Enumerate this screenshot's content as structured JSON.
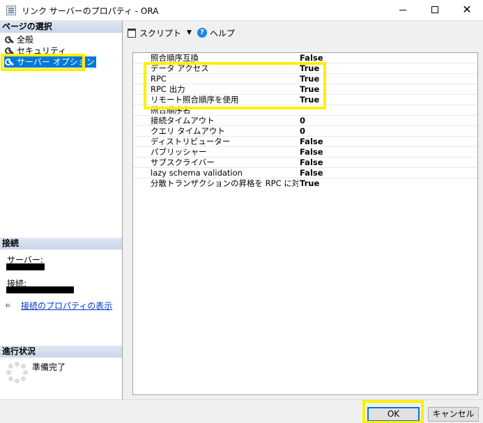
{
  "window": {
    "title": "リンク サーバーのプロパティ - ORA",
    "minimize": "—",
    "close": "✕"
  },
  "left": {
    "page_select_header": "ページの選択",
    "pages": [
      {
        "label": "全般",
        "icon": "wrench-icon"
      },
      {
        "label": "セキュリティ",
        "icon": "wrench-icon"
      },
      {
        "label": "サーバー オプション",
        "icon": "wrench-icon",
        "selected": true
      }
    ],
    "connection_header": "接続",
    "server_label": "サーバー:",
    "connection_label": "接続:",
    "view_connection_props": "接続のプロパティの表示",
    "progress_header": "進行状況",
    "progress_status": "準備完了"
  },
  "toolbar": {
    "script_label": "スクリプト",
    "help_label": "ヘルプ"
  },
  "grid": {
    "rows": [
      {
        "name": "照合順序互換",
        "value": "False"
      },
      {
        "name": "データ アクセス",
        "value": "True"
      },
      {
        "name": "RPC",
        "value": "True"
      },
      {
        "name": "RPC 出力",
        "value": "True"
      },
      {
        "name": "リモート照合順序を使用",
        "value": "True"
      },
      {
        "name": "照合順序名",
        "value": ""
      },
      {
        "name": "接続タイムアウト",
        "value": "0"
      },
      {
        "name": "クエリ タイムアウト",
        "value": "0"
      },
      {
        "name": "ディストリビューター",
        "value": "False"
      },
      {
        "name": "パブリッシャー",
        "value": "False"
      },
      {
        "name": "サブスクライバー",
        "value": "False"
      },
      {
        "name": "lazy schema validation",
        "value": "False"
      },
      {
        "name": "分散トランザクションの昇格を RPC に対して有効にする",
        "value": "True"
      }
    ]
  },
  "buttons": {
    "ok": "OK",
    "cancel": "キャンセル"
  },
  "colors": {
    "highlight": "#ffef00",
    "selection": "#0078d7",
    "link": "#0033cc"
  }
}
